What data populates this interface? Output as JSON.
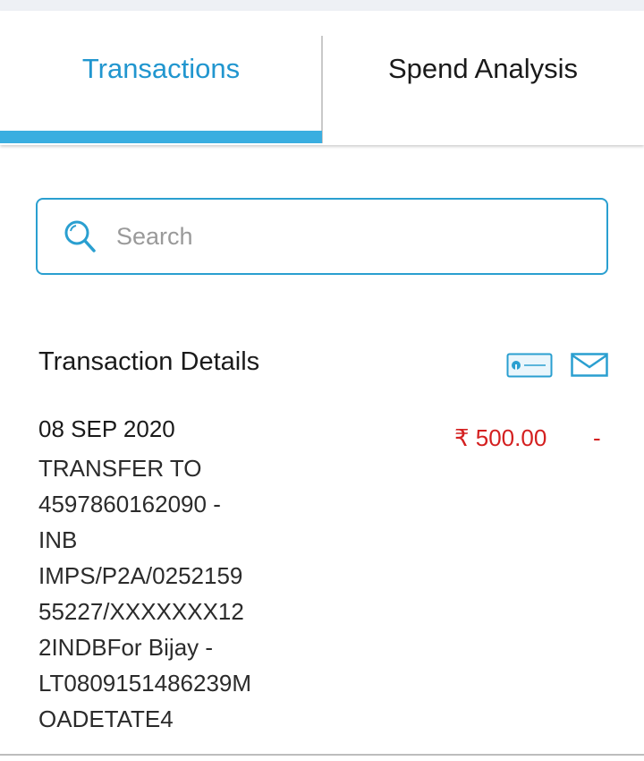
{
  "tabs": [
    {
      "label": "Transactions",
      "active": true
    },
    {
      "label": "Spend Analysis",
      "active": false
    }
  ],
  "search": {
    "placeholder": "Search",
    "value": ""
  },
  "section": {
    "title": "Transaction Details",
    "icons": [
      "passbook-icon",
      "mail-icon"
    ]
  },
  "transaction": {
    "date": "08 SEP 2020",
    "description_lines": [
      "TRANSFER TO",
      "4597860162090 -",
      "INB",
      "IMPS/P2A/0252159",
      "55227/XXXXXXX12",
      "2INDBFor Bijay -",
      "LT0809151486239M",
      "OADETATE4"
    ],
    "debit_amount": "₹ 500.00",
    "credit_amount": "-"
  },
  "colors": {
    "accent": "#2196cf",
    "indicator": "#3aaee0",
    "debit": "#d42020"
  }
}
